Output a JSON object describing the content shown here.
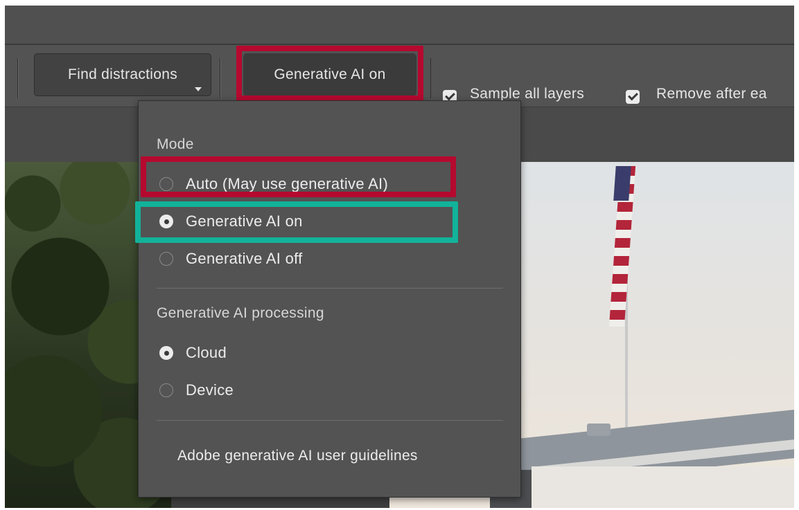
{
  "toolbar": {
    "find_distractions_label": "Find distractions",
    "generative_ai_label": "Generative AI on",
    "sample_all_layers_label": "Sample all layers",
    "sample_all_layers_checked": true,
    "remove_after_label": "Remove after ea",
    "remove_after_checked": true
  },
  "dropdown": {
    "mode_heading": "Mode",
    "mode_options": [
      {
        "label": "Auto (May use generative AI)",
        "selected": false
      },
      {
        "label": "Generative AI on",
        "selected": true
      },
      {
        "label": "Generative AI off",
        "selected": false
      }
    ],
    "processing_heading": "Generative AI processing",
    "processing_options": [
      {
        "label": "Cloud",
        "selected": true
      },
      {
        "label": "Device",
        "selected": false
      }
    ],
    "guidelines_link": "Adobe generative AI user guidelines"
  },
  "annotation_colors": {
    "red": "#b5092f",
    "teal": "#12b39a"
  }
}
